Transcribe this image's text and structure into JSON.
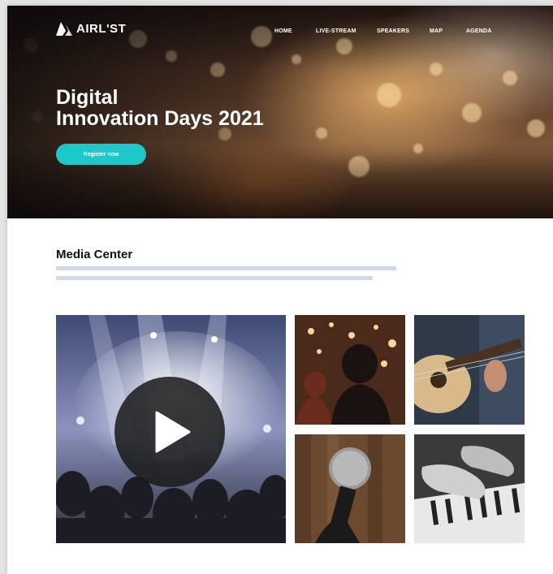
{
  "brand": {
    "name": "AIRL'ST",
    "logo_icon": "mountain-logo-icon"
  },
  "nav": {
    "items": [
      {
        "label": "HOME"
      },
      {
        "label": "LIVE-STREAM"
      },
      {
        "label": "SPEAKERS"
      },
      {
        "label": "MAP"
      },
      {
        "label": "AGENDA"
      }
    ]
  },
  "hero": {
    "title_line1": "Digital",
    "title_line2": "Innovation Days 2021",
    "cta_label": "Register now"
  },
  "media": {
    "title": "Media Center",
    "featured": {
      "icon": "play-icon"
    },
    "thumbnails": [
      {
        "subject": "crowd-lights-photo"
      },
      {
        "subject": "guitar-photo"
      },
      {
        "subject": "microphone-photo"
      },
      {
        "subject": "piano-photo"
      }
    ]
  },
  "colors": {
    "accent": "#1fc8c8",
    "rule": "#d1d9e6",
    "text": "#111111"
  }
}
